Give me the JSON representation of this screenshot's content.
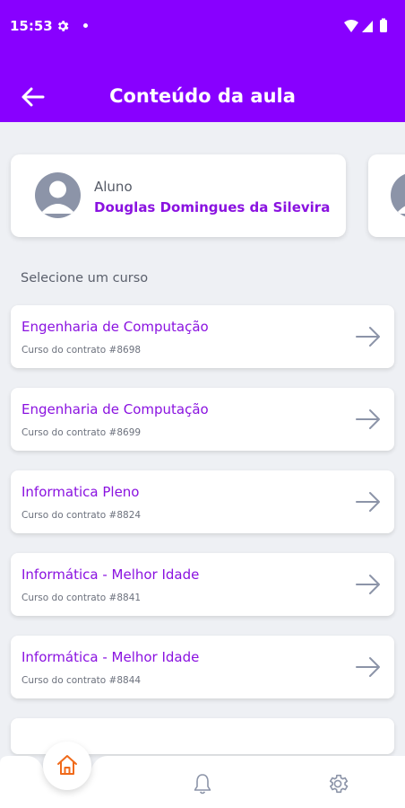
{
  "status_bar": {
    "time": "15:53"
  },
  "header": {
    "title": "Conteúdo da aula"
  },
  "student": {
    "label": "Aluno",
    "name": "Douglas Domingues da Silevira"
  },
  "section": {
    "title": "Selecione um curso"
  },
  "courses": [
    {
      "name": "Engenharia de Computação",
      "contract": "Curso do contrato #8698"
    },
    {
      "name": "Engenharia de Computação",
      "contract": "Curso do contrato #8699"
    },
    {
      "name": "Informatica Pleno",
      "contract": "Curso do contrato #8824"
    },
    {
      "name": "Informática - Melhor Idade",
      "contract": "Curso do contrato #8841"
    },
    {
      "name": "Informática - Melhor Idade",
      "contract": "Curso do contrato #8844"
    }
  ],
  "colors": {
    "header": "#8800ff",
    "accent": "#8a12e0",
    "home_icon": "#f06a1a",
    "nav_icon": "#8c94a8"
  },
  "nav": {
    "items": [
      "home-icon",
      "bell-icon",
      "gear-icon"
    ],
    "active": "home-icon"
  }
}
